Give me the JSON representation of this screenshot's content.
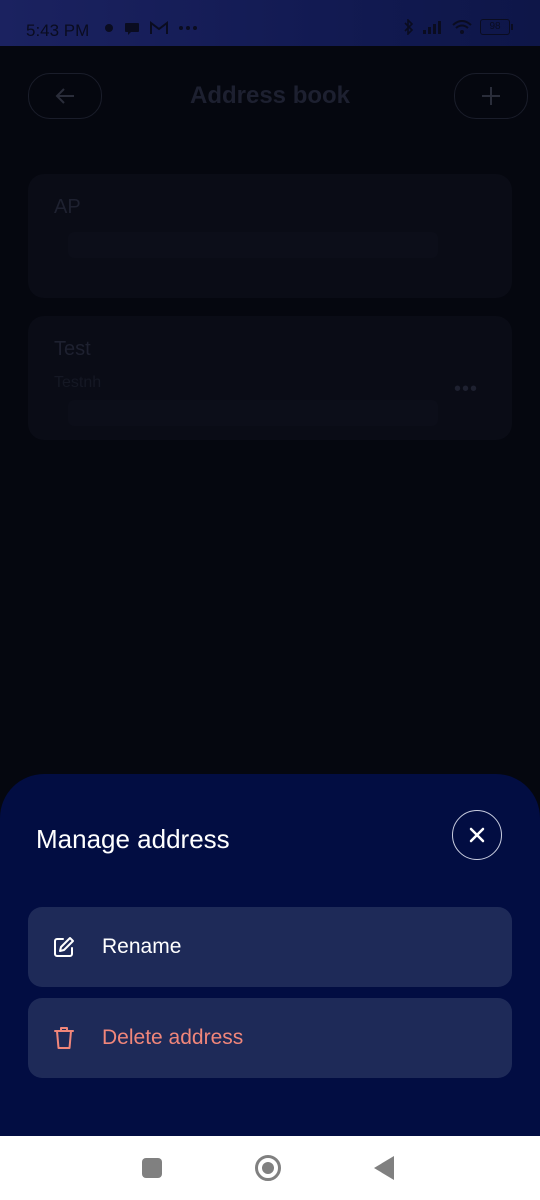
{
  "status_bar": {
    "time": "5:43 PM",
    "battery": "98"
  },
  "app": {
    "title": "Address book",
    "cards": [
      {
        "name": "AP",
        "sub": ""
      },
      {
        "name": "Test",
        "sub": "Testnh"
      }
    ]
  },
  "sheet": {
    "title": "Manage address",
    "actions": [
      {
        "label": "Rename",
        "icon": "edit-icon"
      },
      {
        "label": "Delete address",
        "icon": "trash-icon"
      }
    ]
  },
  "colors": {
    "sheet_bg": "#020d42",
    "action_bg": "#1e2a58",
    "danger": "#f0867a"
  }
}
